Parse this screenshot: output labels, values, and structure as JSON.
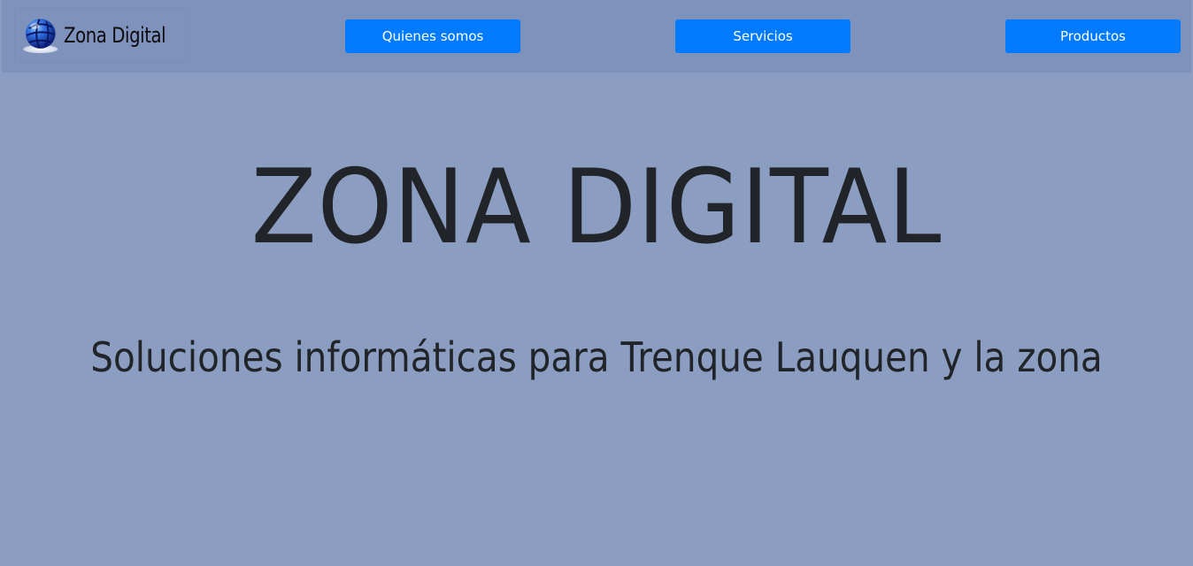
{
  "brand": {
    "name": "Zona Digital",
    "logo_icon": "globe-icon",
    "colors": {
      "page_background": "#8b9dc1",
      "navbar_background": "#7f92bb",
      "button_primary": "#007bff",
      "text_dark": "#212529"
    }
  },
  "nav": {
    "buttons": [
      {
        "label": "Quienes somos"
      },
      {
        "label": "Servicios"
      },
      {
        "label": "Productos"
      }
    ]
  },
  "hero": {
    "title": "ZONA DIGITAL",
    "subtitle": "Soluciones informáticas para Trenque Lauquen y la zona"
  }
}
